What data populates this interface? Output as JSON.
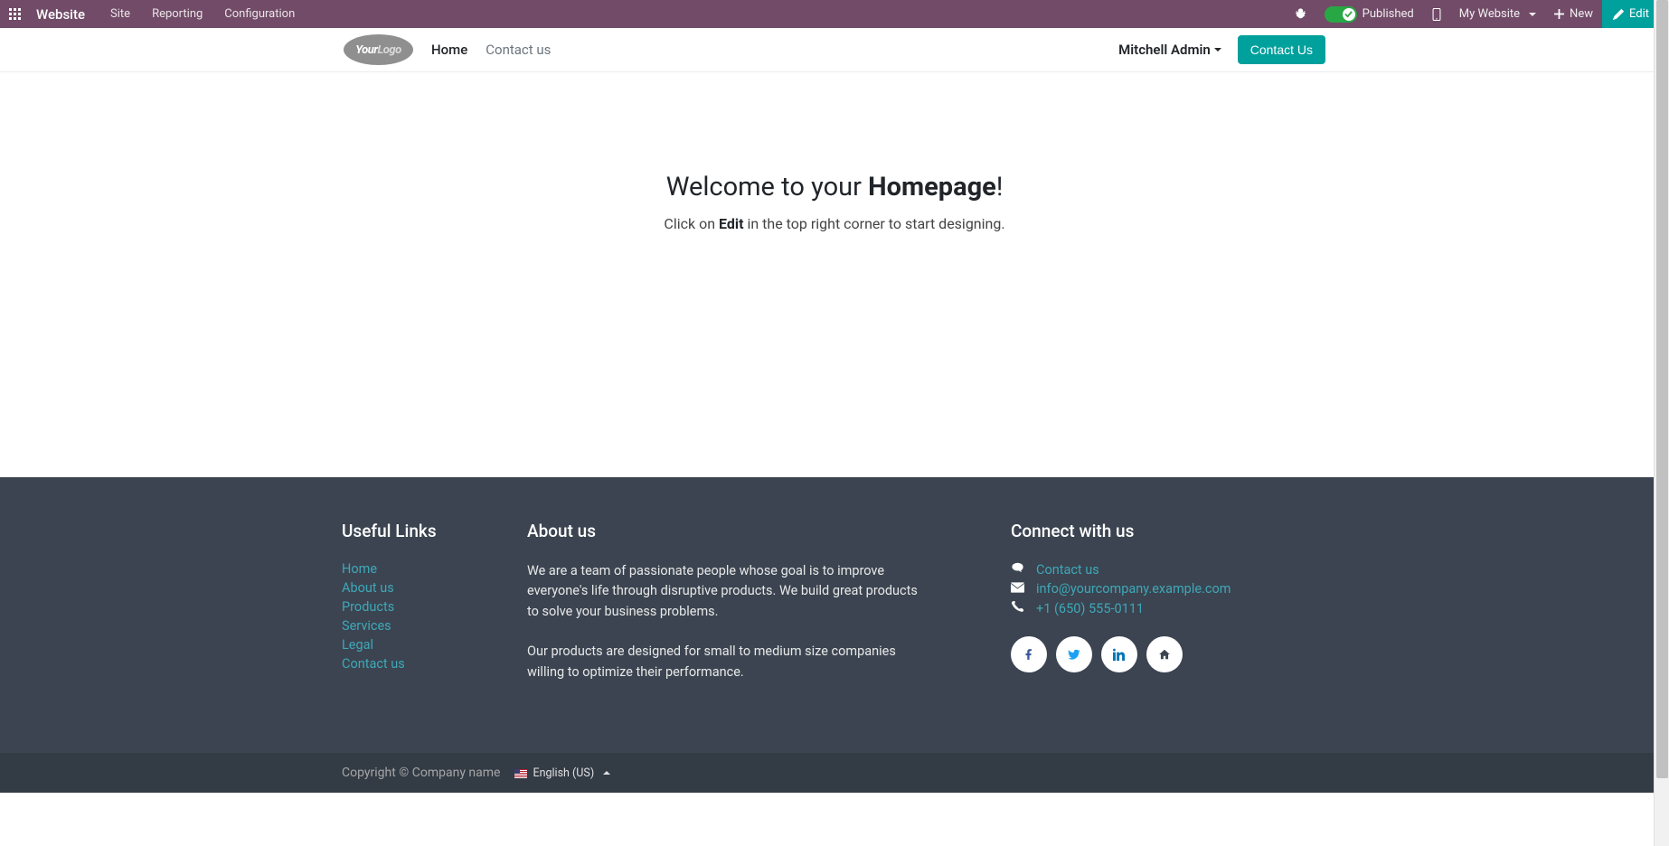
{
  "admin": {
    "app_name": "Website",
    "menus": [
      "Site",
      "Reporting",
      "Configuration"
    ],
    "published_label": "Published",
    "my_website_label": "My Website",
    "new_label": "New",
    "edit_label": "Edit"
  },
  "header": {
    "logo_part1": "Your",
    "logo_part2": "Logo",
    "nav": [
      {
        "label": "Home",
        "active": true
      },
      {
        "label": "Contact us",
        "active": false
      }
    ],
    "user_name": "Mitchell Admin",
    "contact_button": "Contact Us"
  },
  "hero": {
    "title_prefix": "Welcome to your ",
    "title_strong": "Homepage",
    "title_suffix": "!",
    "sub_prefix": "Click on ",
    "sub_strong": "Edit",
    "sub_suffix": " in the top right corner to start designing."
  },
  "footer": {
    "useful_links_title": "Useful Links",
    "useful_links": [
      "Home",
      "About us",
      "Products",
      "Services",
      "Legal",
      "Contact us"
    ],
    "about_title": "About us",
    "about_p1": "We are a team of passionate people whose goal is to improve everyone's life through disruptive products. We build great products to solve your business problems.",
    "about_p2": "Our products are designed for small to medium size companies willing to optimize their performance.",
    "connect_title": "Connect with us",
    "contact_link": "Contact us",
    "email": "info@yourcompany.example.com",
    "phone": "+1 (650) 555-0111"
  },
  "bottom": {
    "copyright": "Copyright © Company name",
    "language": "English (US)"
  }
}
